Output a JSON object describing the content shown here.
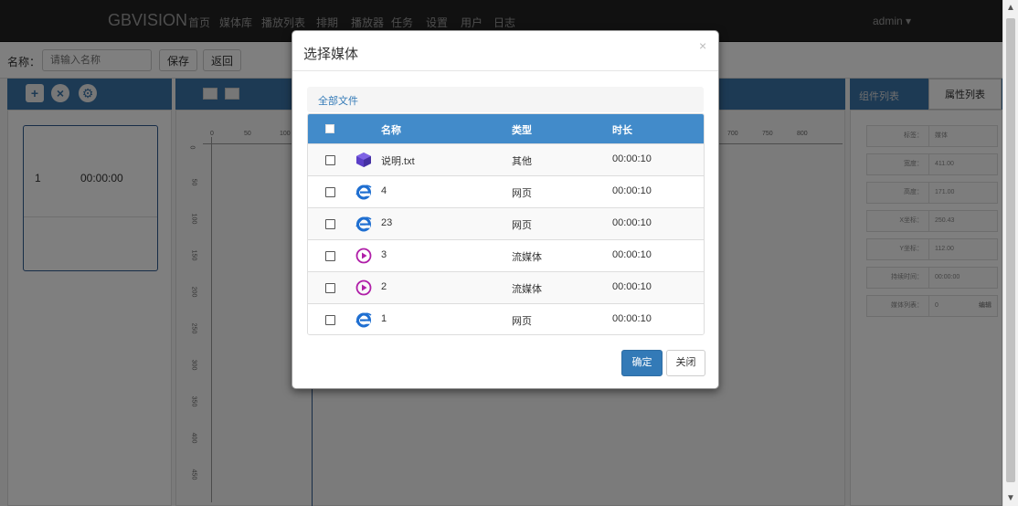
{
  "navbar": {
    "brand": "GBVISION",
    "items": [
      "首页",
      "媒体库",
      "播放列表",
      "排期",
      "播放器",
      "任务",
      "设置",
      "用户",
      "日志"
    ],
    "user": "admin ▾"
  },
  "toolbar": {
    "name_label": "名称：",
    "name_placeholder": "请输入名称",
    "save_label": "保存",
    "back_label": "返回"
  },
  "left_panel": {
    "rows": [
      {
        "index": "1",
        "time": "00:00:00"
      }
    ]
  },
  "canvas": {
    "ruler_top": [
      "0",
      "50",
      "100",
      "700",
      "750",
      "800"
    ],
    "ruler_left": [
      "0",
      "50",
      "100",
      "150",
      "200",
      "250",
      "300",
      "350",
      "400",
      "450"
    ]
  },
  "right_panel": {
    "tab_components": "组件列表",
    "tab_properties": "属性列表",
    "properties": [
      {
        "key": "标签：",
        "value": "媒体"
      },
      {
        "key": "宽度：",
        "value": "411.00"
      },
      {
        "key": "高度：",
        "value": "171.00"
      },
      {
        "key": "X坐标：",
        "value": "250.43"
      },
      {
        "key": "Y坐标：",
        "value": "112.00"
      },
      {
        "key": "持续时间：",
        "value": "00:00:00"
      },
      {
        "key": "媒体列表：",
        "value": "0",
        "edit": "编辑"
      }
    ]
  },
  "modal": {
    "title": "选择媒体",
    "close_symbol": "×",
    "breadcrumb": "全部文件",
    "columns": {
      "name": "名称",
      "type": "类型",
      "duration": "时长"
    },
    "rows": [
      {
        "icon": "cube-icon",
        "name": "说明.txt",
        "type": "其他",
        "duration": "00:00:10"
      },
      {
        "icon": "ie-icon",
        "name": "4",
        "type": "网页",
        "duration": "00:00:10"
      },
      {
        "icon": "ie-icon",
        "name": "23",
        "type": "网页",
        "duration": "00:00:10"
      },
      {
        "icon": "play-circle-icon",
        "name": "3",
        "type": "流媒体",
        "duration": "00:00:10"
      },
      {
        "icon": "play-circle-icon",
        "name": "2",
        "type": "流媒体",
        "duration": "00:00:10"
      },
      {
        "icon": "ie-icon",
        "name": "1",
        "type": "网页",
        "duration": "00:00:10"
      }
    ],
    "ok_label": "确定",
    "close_label": "关闭"
  },
  "colors": {
    "table_header": "#428bca",
    "primary_button": "#337ab7",
    "navbar": "#222222",
    "panel_header": "#3a74a8",
    "stream_icon": "#b01fa8",
    "web_icon": "#1f6fd1",
    "cube_icon": "#5b3fc7"
  }
}
